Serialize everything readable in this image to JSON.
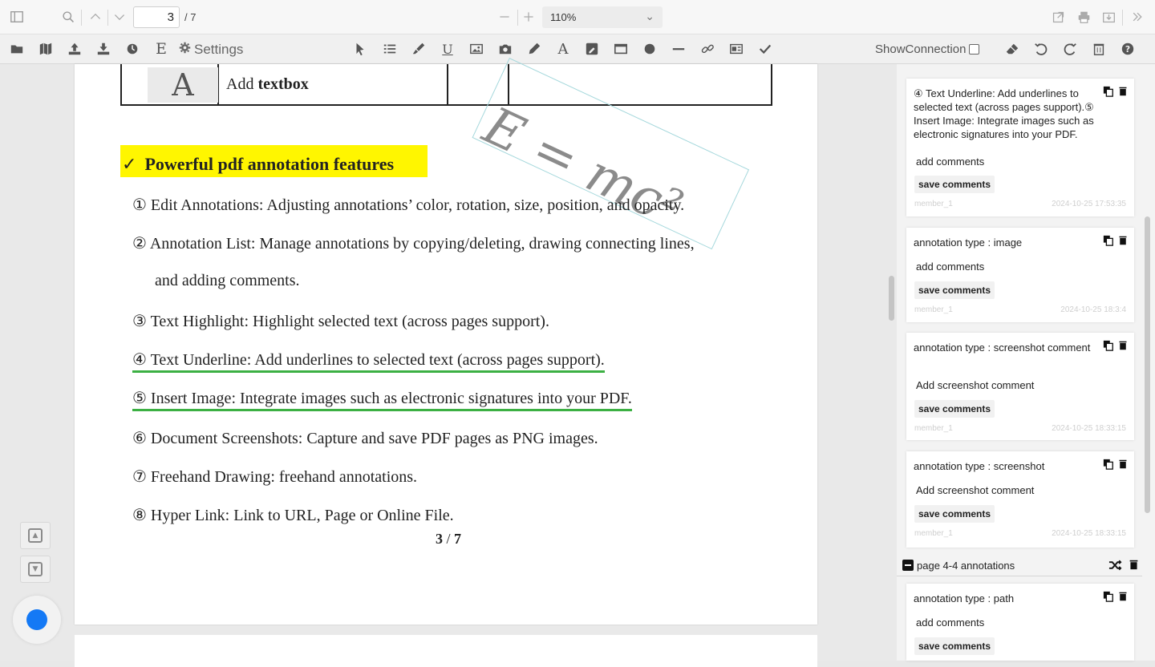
{
  "topbar": {
    "page_current": "3",
    "page_total": "/ 7",
    "zoom": "110%"
  },
  "toolbar": {
    "settings_label": "Settings",
    "show_connection_label": "ShowConnection"
  },
  "document": {
    "table_row_label_plain": "Add ",
    "table_row_label_bold": "textbox",
    "table_glyph": "A",
    "formula": "E = mc²",
    "feature_title": "Powerful pdf annotation features",
    "feature_check": "✓",
    "lines": [
      "① Edit Annotations: Adjusting annotations’ color, rotation, size, position, and opacity.",
      "② Annotation List: Manage annotations by copying/deleting, drawing connecting lines,",
      "and adding comments.",
      "③ Text Highlight: Highlight selected text (across pages support).",
      "④ Text Underline: Add underlines to selected text (across pages support).",
      "⑤ Insert Image: Integrate images such as electronic signatures into your PDF.",
      "⑥ Document Screenshots: Capture and save PDF pages as PNG images.",
      "⑦ Freehand Drawing: freehand annotations.",
      "⑧ Hyper Link: Link to URL, Page or Online File."
    ],
    "page_number_current": "3",
    "page_number_sep": " / ",
    "page_number_total": "7"
  },
  "panel": {
    "cards": [
      {
        "type_text": "④ Text Underline: Add underlines to selected text (across pages support).⑤ Insert Image: Integrate images such as electronic signatures into your PDF.",
        "comment": "add comments",
        "save": "save comments",
        "user": "member_1",
        "time": "2024-10-25 17:53:35"
      },
      {
        "type_text": "annotation type : image",
        "comment": "add comments",
        "save": "save comments",
        "user": "member_1",
        "time": "2024-10-25 18:3:4"
      },
      {
        "type_text": "annotation type : screenshot comment",
        "comment": "Add screenshot comment",
        "save": "save comments",
        "user": "member_1",
        "time": "2024-10-25 18:33:15"
      },
      {
        "type_text": "annotation type : screenshot",
        "comment": "Add screenshot comment",
        "save": "save comments",
        "user": "member_1",
        "time": "2024-10-25 18:33:15"
      }
    ],
    "section_title": "page 4-4 annotations",
    "section_cards": [
      {
        "type_text": "annotation type : path",
        "comment": "add comments",
        "save": "save comments"
      }
    ]
  },
  "colors": {
    "highlight": "#fff600",
    "underline": "#3cb043",
    "fab": "#1479f5"
  }
}
